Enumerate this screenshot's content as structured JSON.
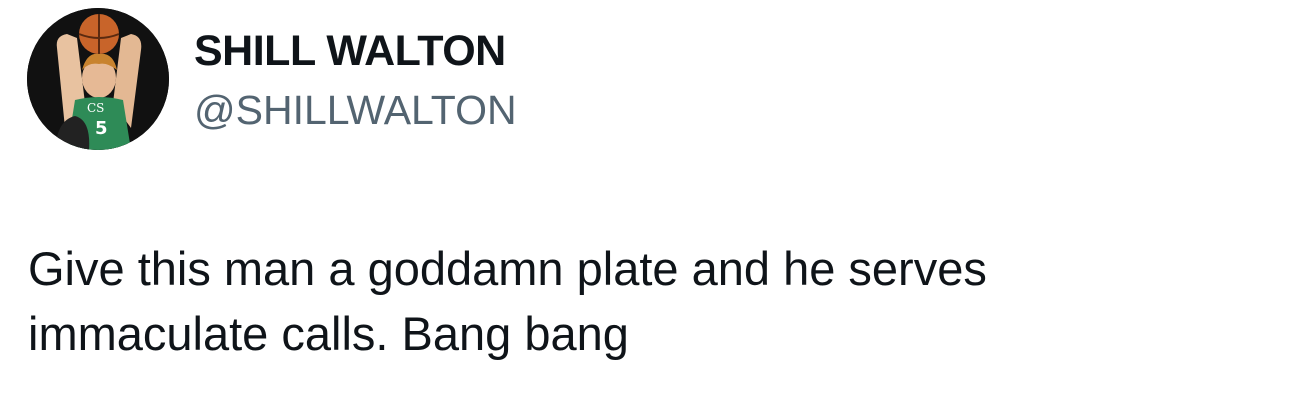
{
  "author": {
    "display_name": "SHILL WALTON",
    "handle": "@SHILLWALTON",
    "avatar_icon": "profile-photo-basketball-player"
  },
  "tweet": {
    "text_lines": [
      "Give this man a goddamn plate and he serves",
      "immaculate calls. Bang bang"
    ]
  },
  "colors": {
    "name": "#0f1419",
    "handle": "#536471",
    "text": "#0f1419",
    "jersey": "#2e8b57"
  }
}
